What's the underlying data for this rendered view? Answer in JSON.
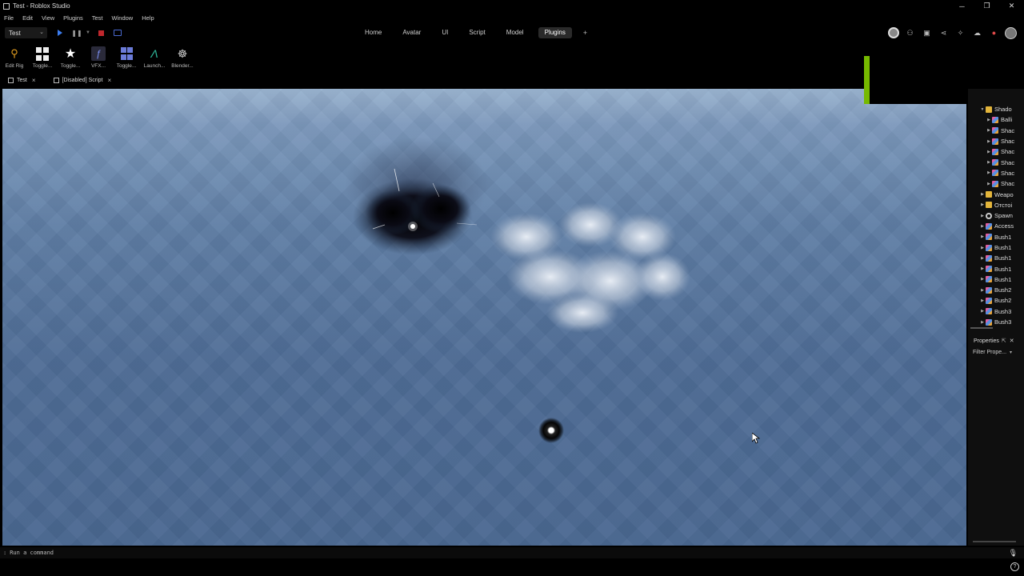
{
  "window": {
    "title": "Test - Roblox Studio",
    "min": "─",
    "max": "❐",
    "close": "✕"
  },
  "menu": [
    "File",
    "Edit",
    "View",
    "Plugins",
    "Test",
    "Window",
    "Help"
  ],
  "ribbon": {
    "place": "Test",
    "tabs": [
      {
        "label": "Home"
      },
      {
        "label": "Avatar"
      },
      {
        "label": "UI"
      },
      {
        "label": "Script"
      },
      {
        "label": "Model"
      },
      {
        "label": "Plugins",
        "active": true
      }
    ],
    "add_tab": "+"
  },
  "plugins": [
    {
      "label": "Edit Rig",
      "icon": "rig-icon"
    },
    {
      "label": "Toggle...",
      "icon": "grid-icon"
    },
    {
      "label": "Toggle...",
      "icon": "star-icon"
    },
    {
      "label": "VFX...",
      "icon": "vfx-icon"
    },
    {
      "label": "Toggle...",
      "icon": "layout-icon"
    },
    {
      "label": "Launch...",
      "icon": "launch-icon"
    },
    {
      "label": "Blender...",
      "icon": "blender-icon"
    }
  ],
  "doc_tabs": [
    {
      "label": "Test",
      "icon": "place-icon"
    },
    {
      "label": "[Disabled] Script",
      "icon": "script-icon"
    }
  ],
  "explorer": {
    "items": [
      {
        "label": "Shado",
        "icon": "folder",
        "level": 0,
        "expanded": true
      },
      {
        "label": "Balli",
        "icon": "model",
        "level": 1
      },
      {
        "label": "Shac",
        "icon": "model",
        "level": 1
      },
      {
        "label": "Shac",
        "icon": "model",
        "level": 1
      },
      {
        "label": "Shac",
        "icon": "model",
        "level": 1
      },
      {
        "label": "Shac",
        "icon": "model",
        "level": 1
      },
      {
        "label": "Shac",
        "icon": "model",
        "level": 1
      },
      {
        "label": "Shac",
        "icon": "model",
        "level": 1
      },
      {
        "label": "Weapo",
        "icon": "folder",
        "level": 0
      },
      {
        "label": "Отстоі",
        "icon": "folder",
        "level": 0
      },
      {
        "label": "Spawn",
        "icon": "spawn",
        "level": 0
      },
      {
        "label": "Access",
        "icon": "model",
        "level": 0
      },
      {
        "label": "Bush1",
        "icon": "model",
        "level": 0
      },
      {
        "label": "Bush1",
        "icon": "model",
        "level": 0
      },
      {
        "label": "Bush1",
        "icon": "model",
        "level": 0
      },
      {
        "label": "Bush1",
        "icon": "model",
        "level": 0
      },
      {
        "label": "Bush1",
        "icon": "model",
        "level": 0
      },
      {
        "label": "Bush2",
        "icon": "model",
        "level": 0
      },
      {
        "label": "Bush2",
        "icon": "model",
        "level": 0
      },
      {
        "label": "Bush3",
        "icon": "model",
        "level": 0
      },
      {
        "label": "Bush3",
        "icon": "model",
        "level": 0
      }
    ]
  },
  "properties": {
    "title": "Properties",
    "filter_placeholder": "Filter Prope..."
  },
  "command_bar": {
    "prompt": ":",
    "placeholder": "Run a command"
  },
  "colors": {
    "accent": "#3c7df0",
    "stop": "#c0272d",
    "overlay_bar": "#76b900",
    "folder": "#e3b53b"
  }
}
